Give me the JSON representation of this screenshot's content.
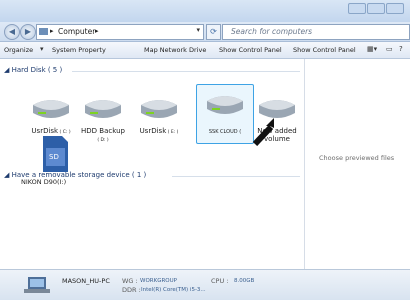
{
  "address": {
    "crumb": "Computer",
    "search_placeholder": "Search for computers"
  },
  "toolbar": {
    "organize": "Organize",
    "system_property": "System Property",
    "map_network_drive": "Map Network Drive",
    "show_control_panel": "Show Control Panel",
    "show_control_panel_2": "Show Control Panel"
  },
  "groups": {
    "hard_disk": {
      "label": "Hard Disk ( 5 )"
    },
    "removable": {
      "label": "Have a removable storage device ( 1 )"
    }
  },
  "drives": [
    {
      "name": "UsrDisk",
      "letter": "( C: )"
    },
    {
      "name": "HDD Backup",
      "letter": "( D: )"
    },
    {
      "name": "UsrDisk",
      "letter": "( E: )"
    },
    {
      "name": "SSK CLOUD (",
      "letter": ""
    },
    {
      "name": "New added",
      "letter": "volume"
    }
  ],
  "sdcard": {
    "label": "NIKON D90(I:)",
    "icon_text": "SD"
  },
  "preview": {
    "text": "Choose previewed files"
  },
  "status": {
    "pc_name": "MASON_HU-PC",
    "wg_label": "WG :",
    "wg_value": "WORKGROUP",
    "cpu_label": "CPU :",
    "cpu_value": "8.00GB",
    "ddr_label": "DDR :",
    "ddr_value": "Intel(R) Core(TM) i5-3..."
  },
  "colors": {
    "accent": "#3ea3e5",
    "group_header": "#1e3b6e"
  }
}
